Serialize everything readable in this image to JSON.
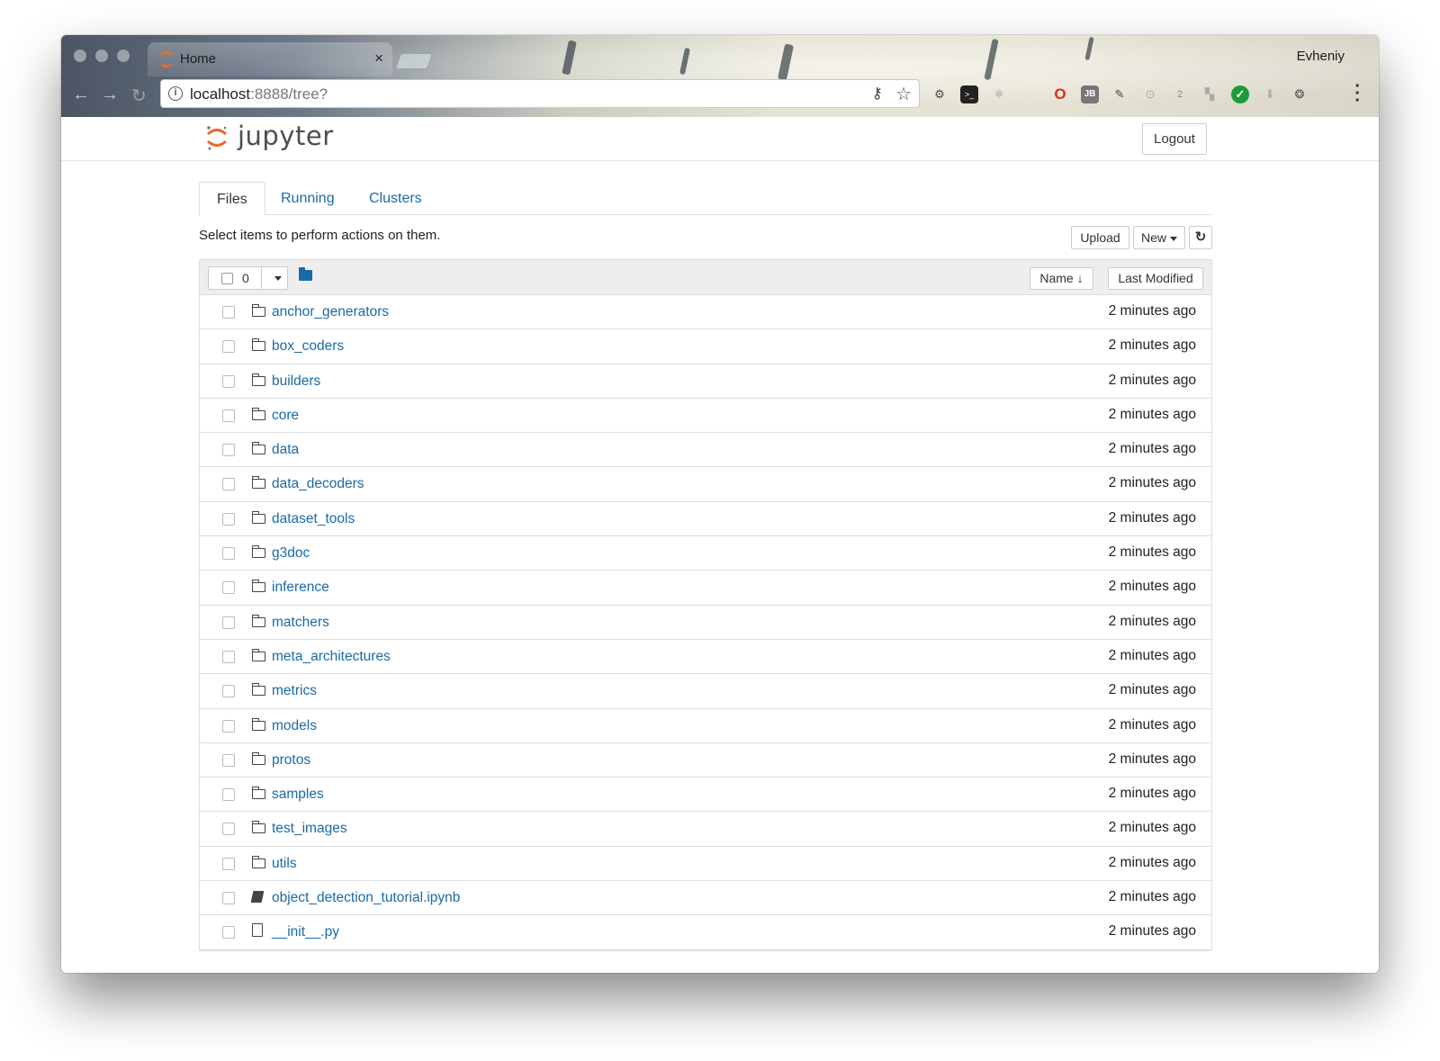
{
  "browser": {
    "tab_title": "Home",
    "tab_close": "×",
    "profile_name": "Evheniy",
    "url_host": "localhost",
    "url_rest": ":8888/tree?",
    "extensions": [
      "gear-icon",
      "terminal-icon",
      "react-icon",
      "sync-icon",
      "opera-icon",
      "jb-icon",
      "eyedropper-icon",
      "code-icon",
      "counter-icon",
      "cast-icon",
      "check-icon",
      "download-icon",
      "fingerprint-icon"
    ],
    "ext_labels": {
      "jb": "JB",
      "counter": "2"
    }
  },
  "header": {
    "logo_text": "jupyter",
    "logout_label": "Logout"
  },
  "tabs": [
    {
      "label": "Files",
      "active": true
    },
    {
      "label": "Running",
      "active": false
    },
    {
      "label": "Clusters",
      "active": false
    }
  ],
  "toolbar": {
    "hint": "Select items to perform actions on them.",
    "upload_label": "Upload",
    "new_label": "New",
    "refresh_icon": "refresh-icon"
  },
  "list_header": {
    "selected_count": "0",
    "sort_name_label": "Name",
    "sort_modified_label": "Last Modified"
  },
  "items": [
    {
      "name": "anchor_generators",
      "type": "folder",
      "modified": "2 minutes ago"
    },
    {
      "name": "box_coders",
      "type": "folder",
      "modified": "2 minutes ago"
    },
    {
      "name": "builders",
      "type": "folder",
      "modified": "2 minutes ago"
    },
    {
      "name": "core",
      "type": "folder",
      "modified": "2 minutes ago"
    },
    {
      "name": "data",
      "type": "folder",
      "modified": "2 minutes ago"
    },
    {
      "name": "data_decoders",
      "type": "folder",
      "modified": "2 minutes ago"
    },
    {
      "name": "dataset_tools",
      "type": "folder",
      "modified": "2 minutes ago"
    },
    {
      "name": "g3doc",
      "type": "folder",
      "modified": "2 minutes ago"
    },
    {
      "name": "inference",
      "type": "folder",
      "modified": "2 minutes ago"
    },
    {
      "name": "matchers",
      "type": "folder",
      "modified": "2 minutes ago"
    },
    {
      "name": "meta_architectures",
      "type": "folder",
      "modified": "2 minutes ago"
    },
    {
      "name": "metrics",
      "type": "folder",
      "modified": "2 minutes ago"
    },
    {
      "name": "models",
      "type": "folder",
      "modified": "2 minutes ago"
    },
    {
      "name": "protos",
      "type": "folder",
      "modified": "2 minutes ago"
    },
    {
      "name": "samples",
      "type": "folder",
      "modified": "2 minutes ago"
    },
    {
      "name": "test_images",
      "type": "folder",
      "modified": "2 minutes ago"
    },
    {
      "name": "utils",
      "type": "folder",
      "modified": "2 minutes ago"
    },
    {
      "name": "object_detection_tutorial.ipynb",
      "type": "notebook",
      "modified": "2 minutes ago"
    },
    {
      "name": "__init__.py",
      "type": "file",
      "modified": "2 minutes ago"
    }
  ],
  "colors": {
    "link": "#1a6aa8",
    "jupyter_orange": "#e46e2e"
  }
}
